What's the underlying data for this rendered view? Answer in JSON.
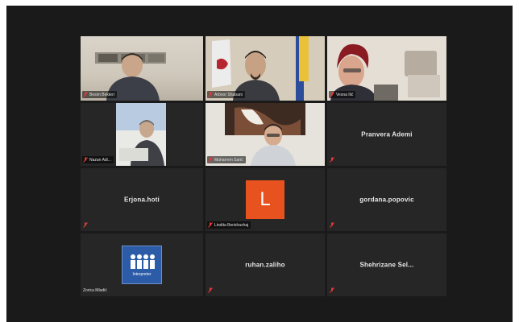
{
  "window": {
    "background": "#1a1a1a",
    "active_speaker_border": "#b8d832"
  },
  "participants": [
    {
      "name": "Besim Bekteri",
      "type": "video",
      "active": true
    },
    {
      "name": "Arbnor Shabani",
      "type": "video"
    },
    {
      "name": "Vesna Ilić",
      "type": "video"
    },
    {
      "name": "Nazan Adi...",
      "type": "video"
    },
    {
      "name": "Muharrem Sarić",
      "type": "video"
    },
    {
      "name": "Pranvera Ademi",
      "type": "name-only"
    },
    {
      "name": "Erjona.hoti",
      "type": "name-only"
    },
    {
      "name": "Lindita Berishaxhaj",
      "type": "avatar",
      "avatar_letter": "L",
      "avatar_color": "#e8521e"
    },
    {
      "name": "gordana.popovic",
      "type": "name-only"
    },
    {
      "name": "Zorica Mladić",
      "type": "logo",
      "logo_text": "Interpreter"
    },
    {
      "name": "ruhan.zaliho",
      "type": "name-only"
    },
    {
      "name": "Shehrizane Sel...",
      "type": "name-only"
    }
  ],
  "icons": {
    "muted": "mic-muted-icon"
  },
  "colors": {
    "muted_icon": "#e53935"
  }
}
